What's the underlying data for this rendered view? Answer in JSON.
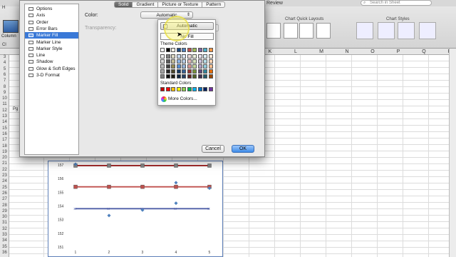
{
  "excel": {
    "search_placeholder": "Search in Sheet",
    "review_tab": "Review",
    "left_h": "H",
    "left_c": "Cl",
    "ribbon": {
      "chart_quick_layouts": "Chart Quick Layouts",
      "chart_styles": "Chart Styles",
      "columns_label": "Column"
    },
    "pg_label": "Pg",
    "columns": [
      "K",
      "L",
      "M",
      "N",
      "O",
      "P",
      "Q",
      "R"
    ],
    "rows": [
      "3",
      "4",
      "5",
      "6",
      "7",
      "8",
      "9",
      "10",
      "11",
      "12",
      "13",
      "14",
      "15",
      "16",
      "17",
      "18",
      "19",
      "20",
      "21",
      "22",
      "23",
      "24",
      "25",
      "26",
      "27",
      "28",
      "29",
      "30",
      "31",
      "32",
      "33",
      "34",
      "35",
      "36"
    ]
  },
  "dialog": {
    "categories": [
      {
        "label": "Options",
        "selected": false
      },
      {
        "label": "Axis",
        "selected": false
      },
      {
        "label": "Order",
        "selected": false
      },
      {
        "label": "Error Bars",
        "selected": false
      },
      {
        "label": "Marker Fill",
        "selected": true
      },
      {
        "label": "Marker Line",
        "selected": false
      },
      {
        "label": "Marker Style",
        "selected": false
      },
      {
        "label": "Line",
        "selected": false
      },
      {
        "label": "Shadow",
        "selected": false
      },
      {
        "label": "Glow & Soft Edges",
        "selected": false
      },
      {
        "label": "3-D Format",
        "selected": false
      }
    ],
    "tabs": [
      {
        "label": "Solid",
        "active": true
      },
      {
        "label": "Gradient",
        "active": false
      },
      {
        "label": "Picture or Texture",
        "active": false
      },
      {
        "label": "Pattern",
        "active": false
      }
    ],
    "color_label": "Color:",
    "color_value": "Automatic",
    "transparency_label": "Transparency:",
    "cancel_label": "Cancel",
    "ok_label": "OK"
  },
  "popup": {
    "automatic_label": "Automatic",
    "nofill_label": "No Fill",
    "theme_label": "Theme Colors",
    "standard_label": "Standard Colors",
    "more_label": "More Colors...",
    "theme_columns": [
      [
        "#ffffff",
        "#f2f2f2",
        "#d9d9d9",
        "#bfbfbf",
        "#a6a6a6",
        "#808080"
      ],
      [
        "#000000",
        "#7f7f7f",
        "#595959",
        "#404040",
        "#262626",
        "#0d0d0d"
      ],
      [
        "#eeece1",
        "#ddd9c3",
        "#c4bd97",
        "#948a54",
        "#4a452a",
        "#1d1b10"
      ],
      [
        "#1f497d",
        "#c6d9f1",
        "#8eb4e3",
        "#558ed5",
        "#17375e",
        "#0f243e"
      ],
      [
        "#4f81bd",
        "#dce6f2",
        "#b9cde5",
        "#95b3d7",
        "#376092",
        "#254061"
      ],
      [
        "#c0504d",
        "#f2dcdb",
        "#e6b9b8",
        "#d99694",
        "#953735",
        "#632523"
      ],
      [
        "#9bbb59",
        "#ebf1de",
        "#d7e4bd",
        "#c3d69b",
        "#77933c",
        "#4f6228"
      ],
      [
        "#8064a2",
        "#e6e0ec",
        "#ccc1da",
        "#b3a2c7",
        "#604a7b",
        "#403152"
      ],
      [
        "#4bacc6",
        "#dbeef4",
        "#b7dee8",
        "#93cddd",
        "#31859c",
        "#215968"
      ],
      [
        "#f79646",
        "#fdeada",
        "#fcd5b5",
        "#fac090",
        "#e46c0a",
        "#984807"
      ]
    ],
    "standard_colors": [
      "#c00000",
      "#ff0000",
      "#ffc000",
      "#ffff00",
      "#92d050",
      "#00b050",
      "#00b0f0",
      "#0070c0",
      "#002060",
      "#7030a0"
    ]
  },
  "chart_data": {
    "type": "line",
    "categories": [
      "1",
      "2",
      "3",
      "4",
      "5"
    ],
    "ylim": [
      151,
      157
    ],
    "yticks": [
      "157",
      "156",
      "155",
      "154",
      "153",
      "152",
      "151"
    ],
    "series": [
      {
        "values": [
          156.95,
          156.95,
          156.95,
          156.95,
          156.95
        ],
        "color": "#a02020"
      },
      {
        "values": [
          155.4,
          155.4,
          155.4,
          155.4,
          155.4
        ],
        "color": "#c0504d"
      },
      {
        "values": [
          153.8,
          153.8,
          153.8,
          153.8,
          153.8
        ],
        "color": "#4f5fa8"
      }
    ],
    "scatter_points": [
      {
        "x": "1",
        "y": 157.05
      },
      {
        "x": "2",
        "y": 153.3
      },
      {
        "x": "3",
        "y": 153.7
      },
      {
        "x": "4",
        "y": 155.7
      },
      {
        "x": "4",
        "y": 154.2
      },
      {
        "x": "5",
        "y": 155.3
      }
    ]
  }
}
